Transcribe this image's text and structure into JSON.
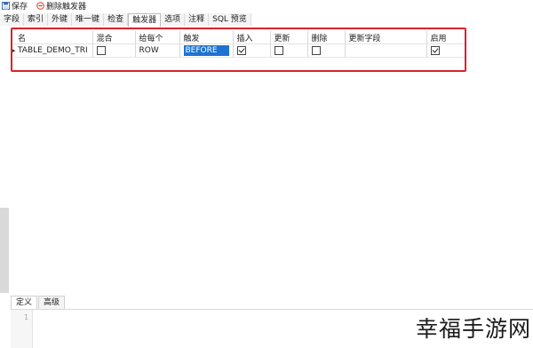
{
  "toolbar": {
    "save_label": "保存",
    "delete_trigger_label": "删除触发器"
  },
  "tabs": [
    {
      "label": "字段"
    },
    {
      "label": "索引"
    },
    {
      "label": "外键"
    },
    {
      "label": "唯一键"
    },
    {
      "label": "检查"
    },
    {
      "label": "触发器",
      "active": true
    },
    {
      "label": "选项"
    },
    {
      "label": "注释"
    },
    {
      "label": "SQL 预览"
    }
  ],
  "table": {
    "columns": [
      "名",
      "混合",
      "给每个",
      "触发",
      "插入",
      "更新",
      "删除",
      "更新字段",
      "启用"
    ],
    "rows": [
      {
        "name": "TABLE_DEMO_TRI",
        "mixed": false,
        "for_each": "ROW",
        "fire": "BEFORE",
        "insert": true,
        "update": false,
        "delete": false,
        "update_fields": "",
        "enabled": true
      }
    ]
  },
  "bottom_tabs": [
    {
      "label": "定义",
      "active": true
    },
    {
      "label": "高级"
    }
  ],
  "editor": {
    "line_number": "1"
  },
  "watermark": {
    "text": "幸福手游网"
  },
  "colors": {
    "highlight_border": "#e0202a",
    "selection": "#1e73d2",
    "delete_icon": "#d33b2c",
    "save_icon": "#3a6fb5"
  }
}
